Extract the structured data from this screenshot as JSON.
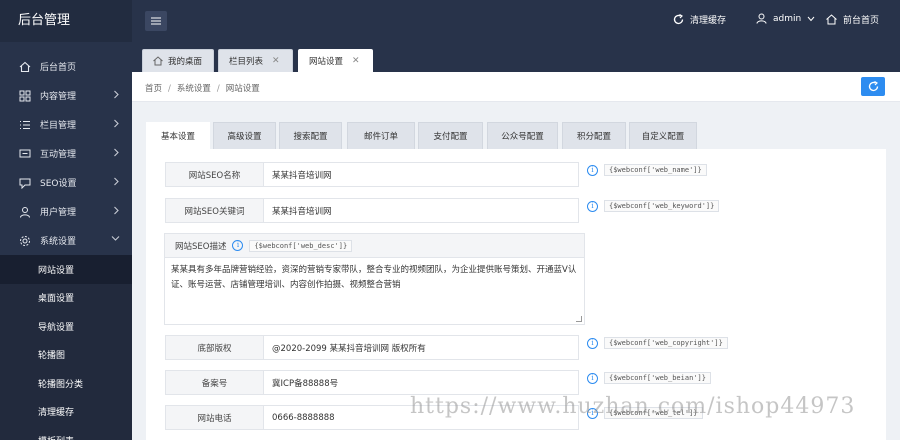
{
  "sidebar": {
    "brand": "后台管理",
    "menu": [
      {
        "label": "后台首页",
        "icon": "home-icon"
      },
      {
        "label": "内容管理",
        "icon": "grid-icon"
      },
      {
        "label": "栏目管理",
        "icon": "list-icon"
      },
      {
        "label": "互动管理",
        "icon": "chat-icon"
      },
      {
        "label": "SEO设置",
        "icon": "seo-icon"
      },
      {
        "label": "用户管理",
        "icon": "user-icon"
      },
      {
        "label": "系统设置",
        "icon": "gear-icon"
      }
    ],
    "submenu": [
      "网站设置",
      "桌面设置",
      "导航设置",
      "轮播图",
      "轮播图分类",
      "清理缓存",
      "模板列表"
    ]
  },
  "header": {
    "clear_cache": "清理缓存",
    "user": "admin",
    "front_home": "前台首页"
  },
  "tabs": [
    {
      "label": "我的桌面"
    },
    {
      "label": "栏目列表"
    },
    {
      "label": "网站设置"
    }
  ],
  "breadcrumb": [
    "首页",
    "系统设置",
    "网站设置"
  ],
  "config_tabs": [
    "基本设置",
    "高级设置",
    "搜索配置",
    "邮件订单",
    "支付配置",
    "公众号配置",
    "积分配置",
    "自定义配置"
  ],
  "fields": {
    "seo_name": {
      "label": "网站SEO名称",
      "value": "某某抖音培训网",
      "code": "{$webconf['web_name']}"
    },
    "seo_keyword": {
      "label": "网站SEO关键词",
      "value": "某某抖音培训网",
      "code": "{$webconf['web_keyword']}"
    },
    "seo_desc": {
      "label": "网站SEO描述",
      "code": "{$webconf['web_desc']}",
      "value": "某某具有多年品牌营销经验，资深的营销专家带队，整合专业的视频团队，为企业提供账号策划、开通蓝V认证、账号运营、店铺管理培训、内容创作拍摄、视频整合营销"
    },
    "copyright": {
      "label": "底部版权",
      "value": "@2020-2099 某某抖音培训网 版权所有",
      "code": "{$webconf['web_copyright']}"
    },
    "beian": {
      "label": "备案号",
      "value": "冀ICP备88888号",
      "code": "{$webconf['web_beian']}"
    },
    "tel": {
      "label": "网站电话",
      "value": "0666-8888888",
      "code": "{$webconf['web_tel']}"
    }
  },
  "watermark": "https://www.huzhan.com/ishop44973",
  "colors": {
    "sidebar": "#28334a",
    "accent": "#2d8cf0"
  }
}
